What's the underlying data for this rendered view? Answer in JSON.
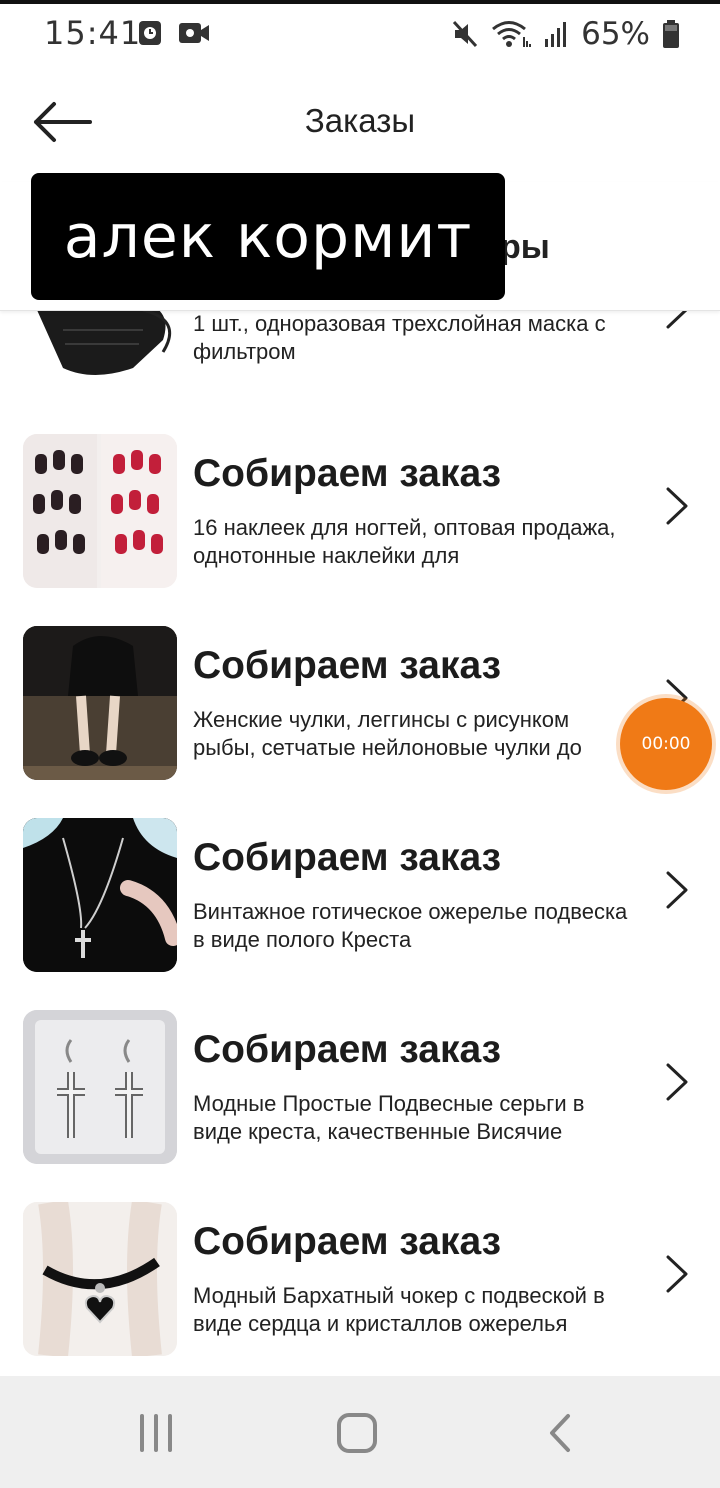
{
  "status_bar": {
    "time": "15:41",
    "battery_percent": "65%",
    "icons": [
      "alarm-icon",
      "video-record-icon",
      "mute-icon",
      "wifi-icon",
      "signal-icon",
      "battery-icon"
    ]
  },
  "header": {
    "title": "Заказы",
    "back_icon": "arrow-left-icon"
  },
  "tabs": {
    "partial_label": "ры"
  },
  "overlay": {
    "caption": "алек кормит"
  },
  "orders": [
    {
      "title": "",
      "description": "1 шт., одноразовая трехслойная маска с фильтром",
      "thumb": "black-face-mask"
    },
    {
      "title": "Собираем заказ",
      "description": "16 наклеек для ногтей, оптовая продажа, однотонные наклейки для",
      "thumb": "nail-stickers"
    },
    {
      "title": "Собираем заказ",
      "description": "Женские чулки, леггинсы с рисунком рыбы, сетчатые нейлоновые чулки до",
      "thumb": "fishnet-stockings"
    },
    {
      "title": "Собираем заказ",
      "description": "Винтажное готическое ожерелье подвеска в виде полого Креста",
      "thumb": "cross-necklace"
    },
    {
      "title": "Собираем заказ",
      "description": "Модные Простые Подвесные серьги в виде креста, качественные Висячие",
      "thumb": "cross-earrings"
    },
    {
      "title": "Собираем заказ",
      "description": "Модный Бархатный чокер с подвеской в виде сердца и кристаллов ожерелья",
      "thumb": "heart-choker"
    }
  ],
  "recording_timer": {
    "label": "00:00",
    "color": "#f07a16"
  },
  "nav_bar": {
    "buttons": [
      "recent-apps-icon",
      "home-icon",
      "back-icon"
    ]
  }
}
